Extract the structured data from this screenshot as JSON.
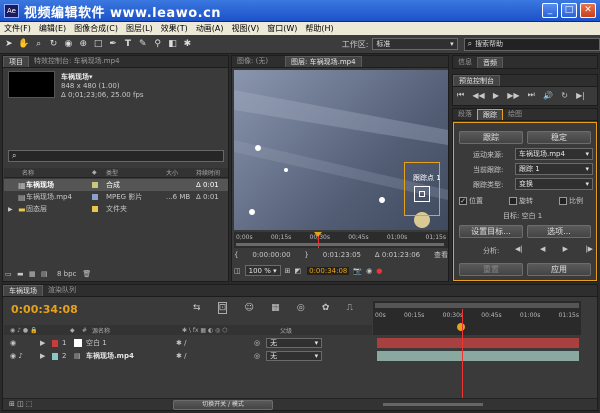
{
  "window": {
    "title": "视频编辑软件  www.leawo.cn",
    "app_icon": "Ae"
  },
  "menu": [
    "文件(F)",
    "编辑(E)",
    "图像合成(C)",
    "图层(L)",
    "效果(T)",
    "动画(A)",
    "视图(V)",
    "窗口(W)",
    "帮助(H)"
  ],
  "toolbar": {
    "workspace_label": "工作区:",
    "workspace_value": "标准",
    "search_placeholder": "搜索帮助"
  },
  "project": {
    "tabs": [
      "项目",
      "特效控制台: 车祸现场.mp4"
    ],
    "item_name": "车祸现场▾",
    "item_info1": "848 x 480 (1.00)",
    "item_info2": "Δ 0;01;23;06, 25.00 fps",
    "columns": [
      "名称",
      "类型",
      "大小",
      "持续时间"
    ],
    "rows": [
      {
        "name": "车祸现场",
        "type": "合成",
        "size": "",
        "dur": "Δ 0:01",
        "color": "#c9c97a",
        "sel": true
      },
      {
        "name": "车祸现场.mp4",
        "type": "MPEG 影片",
        "size": "...6 MB",
        "dur": "Δ 0:01",
        "color": "#8aa0c8",
        "sel": false
      },
      {
        "name": "固态层",
        "type": "文件夹",
        "size": "",
        "dur": "",
        "color": "#e8c84a",
        "sel": false
      }
    ],
    "bpc": "8 bpc"
  },
  "viewer": {
    "tabs": [
      "图像: (无)",
      "图层: 车祸现场.mp4"
    ],
    "track_label": "跟踪点 1",
    "ruler": [
      "0;00s",
      "00;15s",
      "00;30s",
      "00;45s",
      "01;00s",
      "01;15s"
    ],
    "time_start": "0:00:00:00",
    "time_end": "0:01:23:05",
    "time_dur": "Δ 0:01:23:06",
    "view_label": "查看",
    "zoom": "100 %",
    "current_time": "0:00:34:08"
  },
  "info_panel": {
    "tabs": [
      "信息",
      "音频"
    ]
  },
  "preview": {
    "title": "预览控制台"
  },
  "tracker": {
    "tabs": [
      "段落",
      "跟踪",
      "绘图"
    ],
    "track_btn": "跟踪",
    "stabilize_btn": "稳定",
    "source_label": "运动来源:",
    "source_value": "车祸现场.mp4",
    "current_label": "当前跟踪:",
    "current_value": "跟踪 1",
    "type_label": "跟踪类型:",
    "type_value": "变换",
    "cb_position": "位置",
    "cb_rotation": "旋转",
    "cb_scale": "比例",
    "target_text": "目标: 空白 1",
    "set_target_btn": "设置目标...",
    "options_btn": "选项...",
    "analyze_label": "分析:",
    "reset_btn": "重置",
    "apply_btn": "应用"
  },
  "timeline": {
    "tabs": [
      "车祸现场",
      "渲染队列"
    ],
    "time": "0:00:34:08",
    "layer_header": "源名称",
    "parent_header": "父级",
    "ruler": [
      "00s",
      "00:15s",
      "00:30s",
      "00:45s",
      "01:00s",
      "01:15s"
    ],
    "layers": [
      {
        "num": "1",
        "name": "空白 1",
        "parent": "无",
        "color": "#c83c3c",
        "bar": "#a84040"
      },
      {
        "num": "2",
        "name": "车祸现场.mp4",
        "parent": "无",
        "color": "#8ac8c8",
        "bar": "#8aa8a0"
      }
    ],
    "switch_btn": "切换开关 / 模式"
  }
}
